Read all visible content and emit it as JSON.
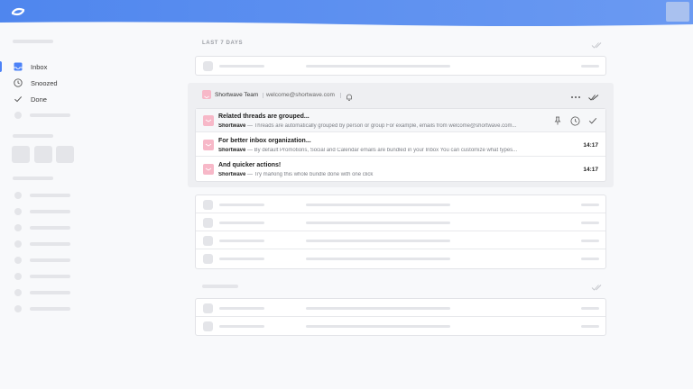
{
  "header": {
    "logo_icon": "shortwave-logo-icon"
  },
  "sidebar": {
    "nav": [
      {
        "label": "Inbox",
        "icon": "inbox-icon",
        "active": true
      },
      {
        "label": "Snoozed",
        "icon": "clock-icon",
        "active": false
      },
      {
        "label": "Done",
        "icon": "check-icon",
        "active": false
      }
    ]
  },
  "main": {
    "section_label": "LAST 7 DAYS",
    "bundle": {
      "sender": "Shortwave Team",
      "email": "welcome@shortwave.com",
      "threads": [
        {
          "subject": "Related threads are grouped...",
          "from": "Shortwave",
          "snippet": " — Threads are automatically grouped by person or group For example, emails from welcome@shortwave.com...",
          "time": ""
        },
        {
          "subject": "For better inbox organization...",
          "from": "Shortwave",
          "snippet": " — By default Promotions, Social and Calendar emails are bundled in your Inbox You can customize what types...",
          "time": "14:17"
        },
        {
          "subject": "And quicker actions!",
          "from": "Shortwave",
          "snippet": " — Try marking this whole bundle done with one click",
          "time": "14:17"
        }
      ]
    }
  },
  "colors": {
    "accent": "#4c82f7",
    "header_blue": "#5b8def",
    "bundle_pink": "#f7b8c8"
  }
}
